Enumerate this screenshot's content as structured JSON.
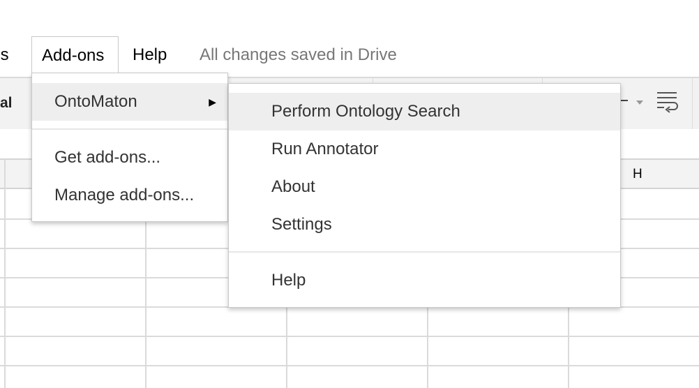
{
  "menubar": {
    "items": [
      {
        "label": "ols"
      },
      {
        "label": "Add-ons",
        "open": true
      },
      {
        "label": "Help"
      }
    ],
    "save_status": "All changes saved in Drive"
  },
  "toolbar": {
    "font_partial": "al",
    "text_wrap_icon": "text-wrap-icon"
  },
  "columns": {
    "visible_header": "H"
  },
  "addons_menu": {
    "items": [
      {
        "label": "OntoMaton",
        "has_submenu": true,
        "highlighted": true,
        "arrow": "▶"
      },
      {
        "label": "Get add-ons..."
      },
      {
        "label": "Manage add-ons..."
      }
    ]
  },
  "ontomaton_submenu": {
    "items": [
      {
        "label": "Perform Ontology Search",
        "highlighted": true
      },
      {
        "label": "Run Annotator"
      },
      {
        "label": "About"
      },
      {
        "label": "Settings"
      },
      {
        "label": "Help"
      }
    ]
  }
}
